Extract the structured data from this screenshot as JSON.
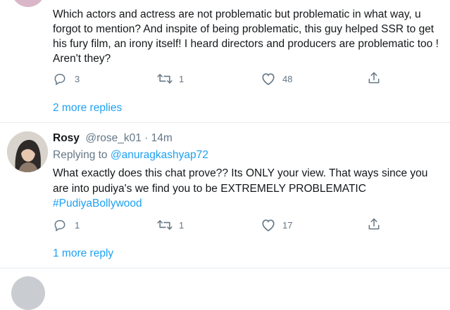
{
  "thread": {
    "tweet1": {
      "text": "Which actors and actress are not problematic but problematic in what way, u forgot to mention? And inspite of being problematic, this guy helped SSR to get his fury film, an irony itself! I heard directors and producers are problematic too ! Aren't they?",
      "actions": {
        "replies": "3",
        "retweets": "1",
        "likes": "48"
      },
      "more_replies": "2 more replies"
    },
    "tweet2": {
      "name": "Rosy",
      "handle": "@rose_k01 · 14m",
      "replying_prefix": "Replying to",
      "replying_to": "@anuragkashyap72",
      "text_line1": "What exactly does this chat prove?? Its ONLY your view.  That ways since you",
      "text_line2": "are into pudiya's we find you to be EXTREMELY PROBLEMATIC",
      "hashtag": "#PudiyaBollywood",
      "actions": {
        "replies": "1",
        "retweets": "1",
        "likes": "17"
      },
      "more_replies": "1 more reply"
    }
  },
  "colors": {
    "accent": "#1da1f2",
    "text": "#14171a",
    "muted": "#657786",
    "divider": "#e6ecf0"
  }
}
